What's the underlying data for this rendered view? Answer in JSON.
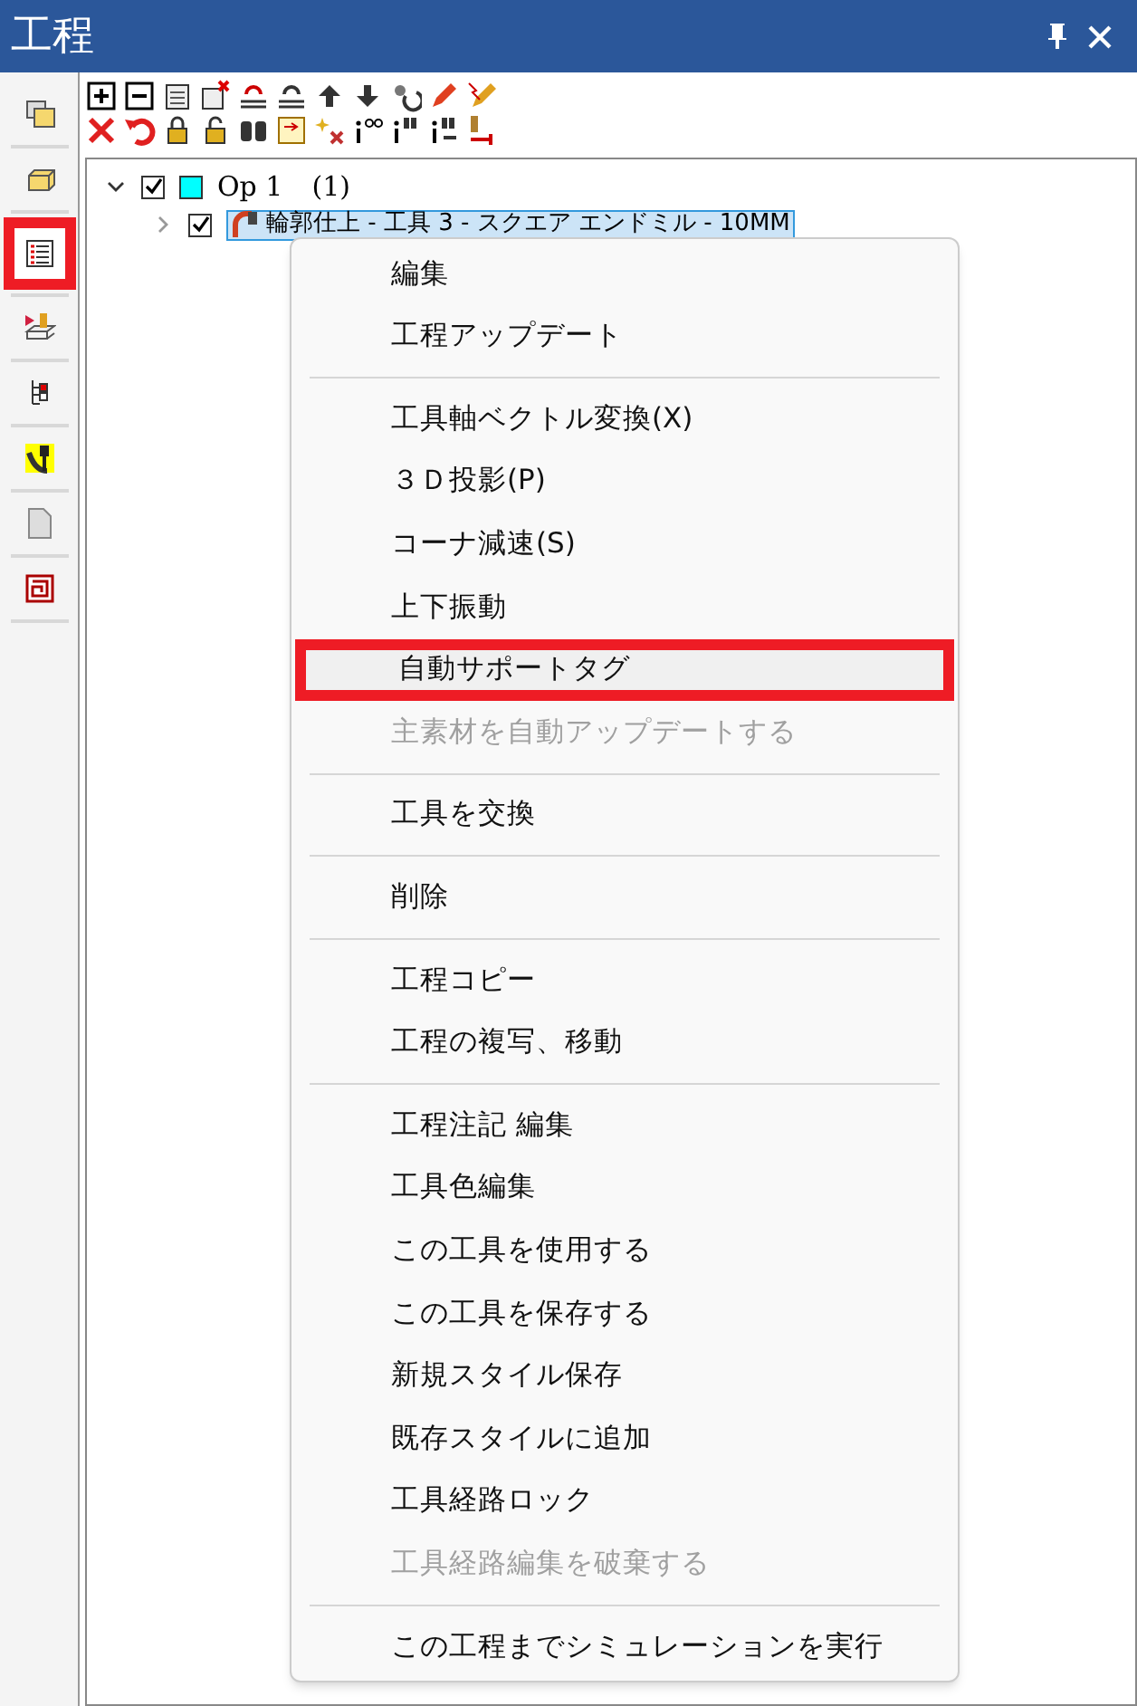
{
  "window": {
    "title": "工程"
  },
  "sidebar": {
    "items": [
      {
        "highlighted": false
      },
      {
        "highlighted": false
      },
      {
        "highlighted": true
      },
      {
        "highlighted": false
      },
      {
        "highlighted": false
      },
      {
        "highlighted": false
      },
      {
        "highlighted": false
      },
      {
        "highlighted": false
      }
    ]
  },
  "tree": {
    "items": [
      {
        "label": "Op 1",
        "count": "(1)",
        "expanded": true,
        "checked": true,
        "color": "#00ffff",
        "children": [
          {
            "label": "輪郭仕上 - 工具 3 - スクエア エンドミル - 10MM",
            "expanded": false,
            "checked": true,
            "selected": true
          }
        ]
      }
    ]
  },
  "context_menu": {
    "items": [
      {
        "kind": "item",
        "label": "編集",
        "disabled": false,
        "highlighted": false
      },
      {
        "kind": "item",
        "label": "工程アップデート",
        "disabled": false,
        "highlighted": false
      },
      {
        "kind": "separator"
      },
      {
        "kind": "item",
        "label": "工具軸ベクトル変換(X)",
        "disabled": false,
        "highlighted": false
      },
      {
        "kind": "item",
        "label": "３Ｄ投影(P)",
        "disabled": false,
        "highlighted": false
      },
      {
        "kind": "item",
        "label": "コーナ減速(S)",
        "disabled": false,
        "highlighted": false
      },
      {
        "kind": "item",
        "label": "上下振動",
        "disabled": false,
        "highlighted": false
      },
      {
        "kind": "item",
        "label": "自動サポートタグ",
        "disabled": false,
        "highlighted": true
      },
      {
        "kind": "item",
        "label": "主素材を自動アップデートする",
        "disabled": true,
        "highlighted": false
      },
      {
        "kind": "separator"
      },
      {
        "kind": "item",
        "label": "工具を交換",
        "disabled": false,
        "highlighted": false
      },
      {
        "kind": "separator"
      },
      {
        "kind": "item",
        "label": "削除",
        "disabled": false,
        "highlighted": false
      },
      {
        "kind": "separator"
      },
      {
        "kind": "item",
        "label": "工程コピー",
        "disabled": false,
        "highlighted": false
      },
      {
        "kind": "item",
        "label": "工程の複写、移動",
        "disabled": false,
        "highlighted": false
      },
      {
        "kind": "separator"
      },
      {
        "kind": "item",
        "label": "工程注記 編集",
        "disabled": false,
        "highlighted": false
      },
      {
        "kind": "item",
        "label": "工具色編集",
        "disabled": false,
        "highlighted": false
      },
      {
        "kind": "item",
        "label": "この工具を使用する",
        "disabled": false,
        "highlighted": false
      },
      {
        "kind": "item",
        "label": "この工具を保存する",
        "disabled": false,
        "highlighted": false
      },
      {
        "kind": "item",
        "label": "新規スタイル保存",
        "disabled": false,
        "highlighted": false
      },
      {
        "kind": "item",
        "label": "既存スタイルに追加",
        "disabled": false,
        "highlighted": false
      },
      {
        "kind": "item",
        "label": "工具経路ロック",
        "disabled": false,
        "highlighted": false
      },
      {
        "kind": "item",
        "label": "工具経路編集を破棄する",
        "disabled": true,
        "highlighted": false
      },
      {
        "kind": "separator"
      },
      {
        "kind": "item",
        "label": "この工程までシミュレーションを実行",
        "disabled": false,
        "highlighted": false
      }
    ]
  }
}
